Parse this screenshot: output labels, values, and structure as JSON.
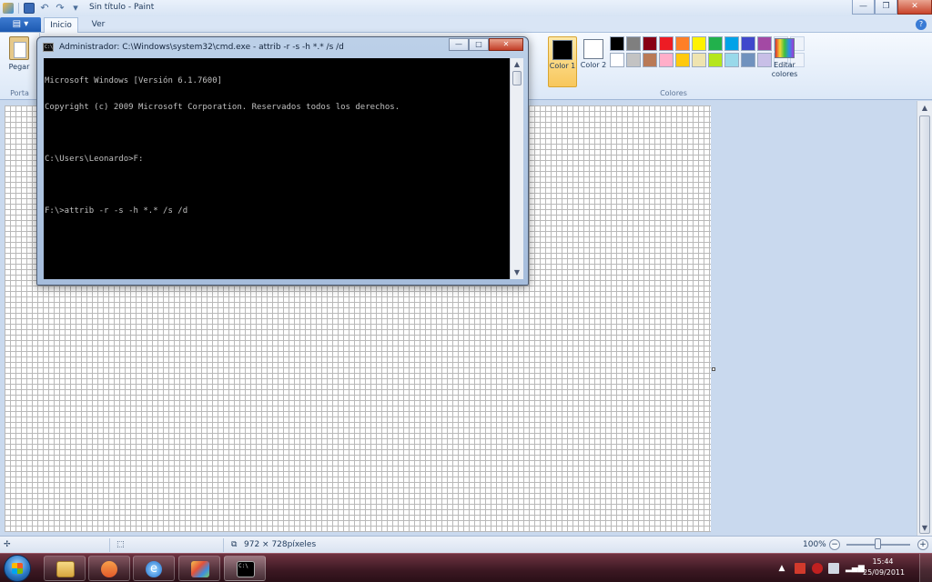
{
  "window": {
    "title": "Sin título - Paint",
    "minimize": "—",
    "maximize": "❐",
    "close": "✕"
  },
  "ribbon": {
    "file_tab": "▤ ▾",
    "tabs": [
      {
        "label": "Inicio",
        "active": true
      },
      {
        "label": "Ver",
        "active": false
      }
    ],
    "help": "?",
    "clipboard": {
      "paste_label": "Pegar",
      "group_label": "Porta"
    },
    "colors": {
      "color1_label": "Color 1",
      "color2_label": "Color 2",
      "color1_value": "#000000",
      "color2_value": "#ffffff",
      "group_label": "Colores",
      "edit_colors_label": "Editar colores",
      "palette": [
        "#000000",
        "#7f7f7f",
        "#880015",
        "#ed1c24",
        "#ff7f27",
        "#fff200",
        "#22b14c",
        "#00a2e8",
        "#3f48cc",
        "#a349a4",
        "#ffffff",
        "#c3c3c3",
        "#b97a57",
        "#ffaec9",
        "#ffc90e",
        "#efe4b0",
        "#b5e61d",
        "#99d9ea",
        "#7092be",
        "#c8bfe7"
      ]
    }
  },
  "cmd": {
    "title": "Administrador: C:\\Windows\\system32\\cmd.exe - attrib  -r -s -h *.* /s /d",
    "icon_text": "C:\\",
    "lines": [
      "Microsoft Windows [Versión 6.1.7600]",
      "Copyright (c) 2009 Microsoft Corporation. Reservados todos los derechos.",
      "",
      "C:\\Users\\Leonardo>F:",
      "",
      "F:\\>attrib -r -s -h *.* /s /d"
    ],
    "minimize": "—",
    "maximize": "□",
    "close": "✕"
  },
  "statusbar": {
    "image_size": "972 × 728píxeles",
    "zoom": "100%",
    "zoom_out": "−",
    "zoom_in": "+"
  },
  "taskbar": {
    "clock_time": "15:44",
    "clock_date": "25/09/2011",
    "tray_expand": "▲"
  },
  "icons": {
    "paint": "paint-app-icon",
    "save": "save-icon",
    "undo": "undo-icon",
    "redo": "redo-icon",
    "explorer": "folder-icon",
    "media": "media-player-icon",
    "ie": "internet-explorer-icon",
    "paint_taskbar": "paint-taskbar-icon",
    "cmd_taskbar": "cmd-taskbar-icon"
  }
}
